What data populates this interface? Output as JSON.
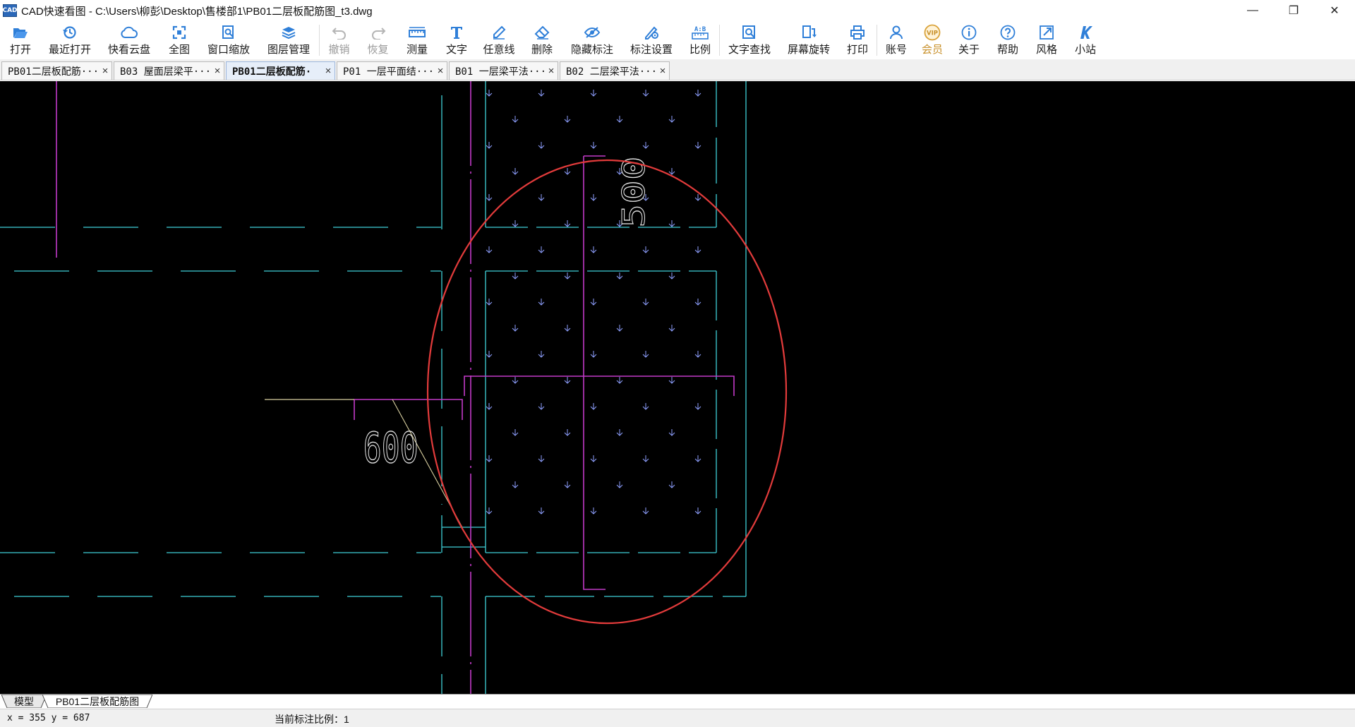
{
  "window": {
    "icon_text": "CAD",
    "title": "CAD快速看图 - C:\\Users\\柳彭\\Desktop\\售楼部1\\PB01二层板配筋图_t3.dwg",
    "minimize": "—",
    "restore": "❐",
    "close": "✕"
  },
  "toolbar": {
    "items": [
      {
        "label": "打开",
        "icon": "folder-open-icon"
      },
      {
        "label": "最近打开",
        "icon": "history-icon"
      },
      {
        "label": "快看云盘",
        "icon": "cloud-icon"
      },
      {
        "label": "全图",
        "icon": "fit-all-icon"
      },
      {
        "label": "窗口缩放",
        "icon": "zoom-window-icon"
      },
      {
        "label": "图层管理",
        "icon": "layers-icon"
      },
      {
        "label": "撤销",
        "icon": "undo-icon",
        "disabled": true
      },
      {
        "label": "恢复",
        "icon": "redo-icon",
        "disabled": true
      },
      {
        "label": "测量",
        "icon": "ruler-icon"
      },
      {
        "label": "文字",
        "icon": "text-icon"
      },
      {
        "label": "任意线",
        "icon": "pen-icon"
      },
      {
        "label": "删除",
        "icon": "eraser-icon"
      },
      {
        "label": "隐藏标注",
        "icon": "eye-hide-icon"
      },
      {
        "label": "标注设置",
        "icon": "dimension-settings-icon"
      },
      {
        "label": "比例",
        "icon": "scale-icon"
      },
      {
        "label": "文字查找",
        "icon": "text-search-icon"
      },
      {
        "label": "屏幕旋转",
        "icon": "screen-rotate-icon"
      },
      {
        "label": "打印",
        "icon": "printer-icon"
      },
      {
        "label": "账号",
        "icon": "user-icon"
      },
      {
        "label": "会员",
        "icon": "vip-icon",
        "badge": "VIP"
      },
      {
        "label": "关于",
        "icon": "info-icon"
      },
      {
        "label": "帮助",
        "icon": "help-icon"
      },
      {
        "label": "风格",
        "icon": "style-icon"
      },
      {
        "label": "小站",
        "icon": "k-station-icon"
      }
    ],
    "scale_icon_text": "A:B"
  },
  "tabs": [
    {
      "label": "PB01二层板配筋···",
      "active": false
    },
    {
      "label": "B03 屋面层梁平···",
      "active": false
    },
    {
      "label": "PB01二层板配筋·",
      "active": true
    },
    {
      "label": "P01 一层平面结···",
      "active": false
    },
    {
      "label": "B01 一层梁平法···",
      "active": false
    },
    {
      "label": "B02 二层梁平法···",
      "active": false
    }
  ],
  "tab_close": "×",
  "drawing": {
    "dim_labels": {
      "horizontal": "600",
      "vertical": "500"
    },
    "colors": {
      "background": "#000000",
      "cyan": "#3fd0d8",
      "magenta": "#c23ac8",
      "hatch": "#8fa0ff",
      "annotation": "#e23b3b",
      "text": "#e8e8e8",
      "leader": "#d9d0a0"
    }
  },
  "layout_tabs": {
    "model": "模型",
    "layout": "PB01二层板配筋图"
  },
  "status": {
    "coords": "x = 355  y = 687",
    "scale_label": "当前标注比例：1"
  }
}
